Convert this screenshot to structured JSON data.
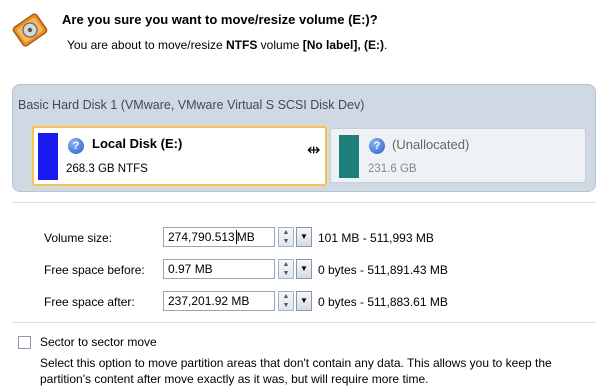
{
  "header": {
    "title": "Are you sure you want to move/resize volume (E:)?",
    "subtitle_prefix": "You are about to move/resize ",
    "subtitle_fs": "NTFS",
    "subtitle_mid": " volume ",
    "subtitle_label": "[No label], (E:)",
    "subtitle_suffix": "."
  },
  "disk": {
    "title": "Basic Hard Disk 1 (VMware, VMware Virtual S SCSI Disk Dev)",
    "partitions": [
      {
        "name": "Local Disk (E:)",
        "info": "268.3 GB NTFS",
        "color": "#1a1aee",
        "selected": true
      },
      {
        "name": "(Unallocated)",
        "info": "231.6 GB",
        "color": "#1c7f79",
        "selected": false
      }
    ]
  },
  "fields": [
    {
      "label": "Volume size:",
      "value": "274,790.513",
      "unit": "MB",
      "range": "101 MB - 511,993 MB"
    },
    {
      "label": "Free space before:",
      "value": "0.97 MB",
      "range": "0 bytes - 511,891.43 MB"
    },
    {
      "label": "Free space after:",
      "value": "237,201.92 MB",
      "range": "0 bytes - 511,883.61 MB"
    }
  ],
  "sector_move": {
    "label": "Sector to sector move",
    "checked": false,
    "description": "Select this option to move partition areas that don't contain any data. This allows you to keep the partition's content after move exactly as it was, but will require more time."
  }
}
